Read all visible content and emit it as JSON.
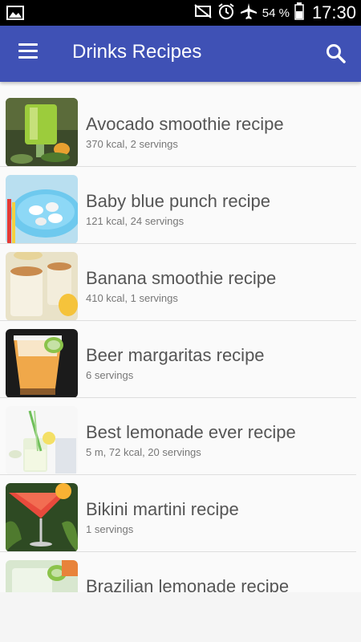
{
  "status_bar": {
    "battery_percent": "54 %",
    "time": "17:30",
    "icons": [
      "gallery-icon",
      "mute-icon",
      "alarm-icon",
      "airplane-icon",
      "battery-icon"
    ]
  },
  "app_bar": {
    "title": "Drinks Recipes",
    "color": "#3f51b5",
    "left_icon": "menu-icon",
    "right_icon": "search-icon"
  },
  "recipes": [
    {
      "title": "Avocado smoothie recipe",
      "details": "370 kcal, 2 servings"
    },
    {
      "title": "Baby blue punch recipe",
      "details": "121 kcal, 24 servings"
    },
    {
      "title": "Banana smoothie recipe",
      "details": "410 kcal, 1 servings"
    },
    {
      "title": "Beer margaritas recipe",
      "details": "6 servings"
    },
    {
      "title": "Best lemonade ever recipe",
      "details": "5 m, 72 kcal, 20 servings"
    },
    {
      "title": "Bikini martini recipe",
      "details": "1 servings"
    },
    {
      "title": "Brazilian lemonade recipe",
      "details": ""
    }
  ]
}
